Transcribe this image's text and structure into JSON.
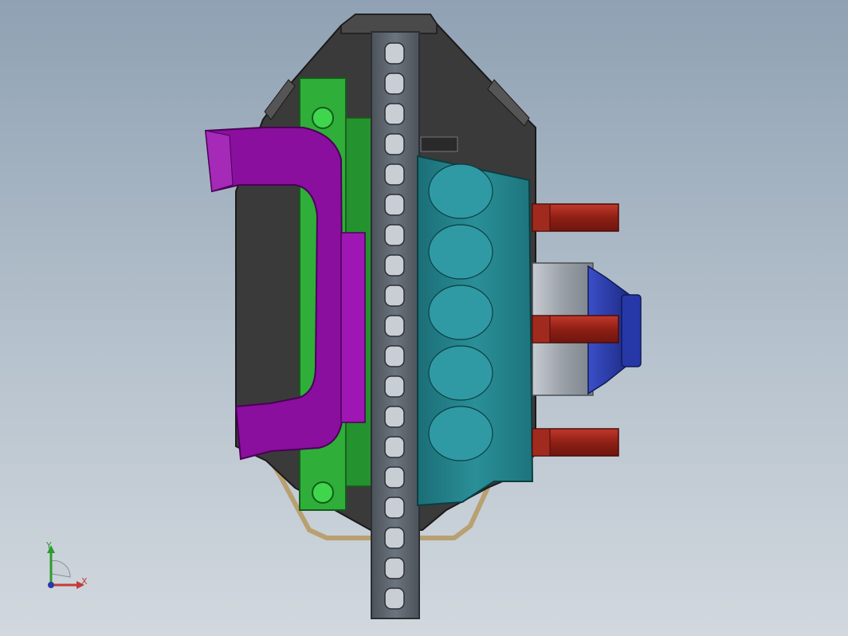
{
  "view": {
    "triad": {
      "x_label": "X",
      "y_label": "Y"
    },
    "colors": {
      "housing": "#3a3a3a",
      "caliper_bracket": "#8a0f9e",
      "mount_plate": "#2fae3a",
      "brake_disc": "#5e6670",
      "hub": "#1f7f87",
      "wheel_studs": "#a0281d",
      "spindle_nut": "#2a3ba8",
      "brake_line": "#b8a070"
    },
    "parts": [
      "housing",
      "caliper-bracket",
      "mount-plate",
      "brake-disc",
      "wheel-hub",
      "wheel-stud",
      "spindle-collar",
      "spindle-nut",
      "brake-line"
    ]
  }
}
